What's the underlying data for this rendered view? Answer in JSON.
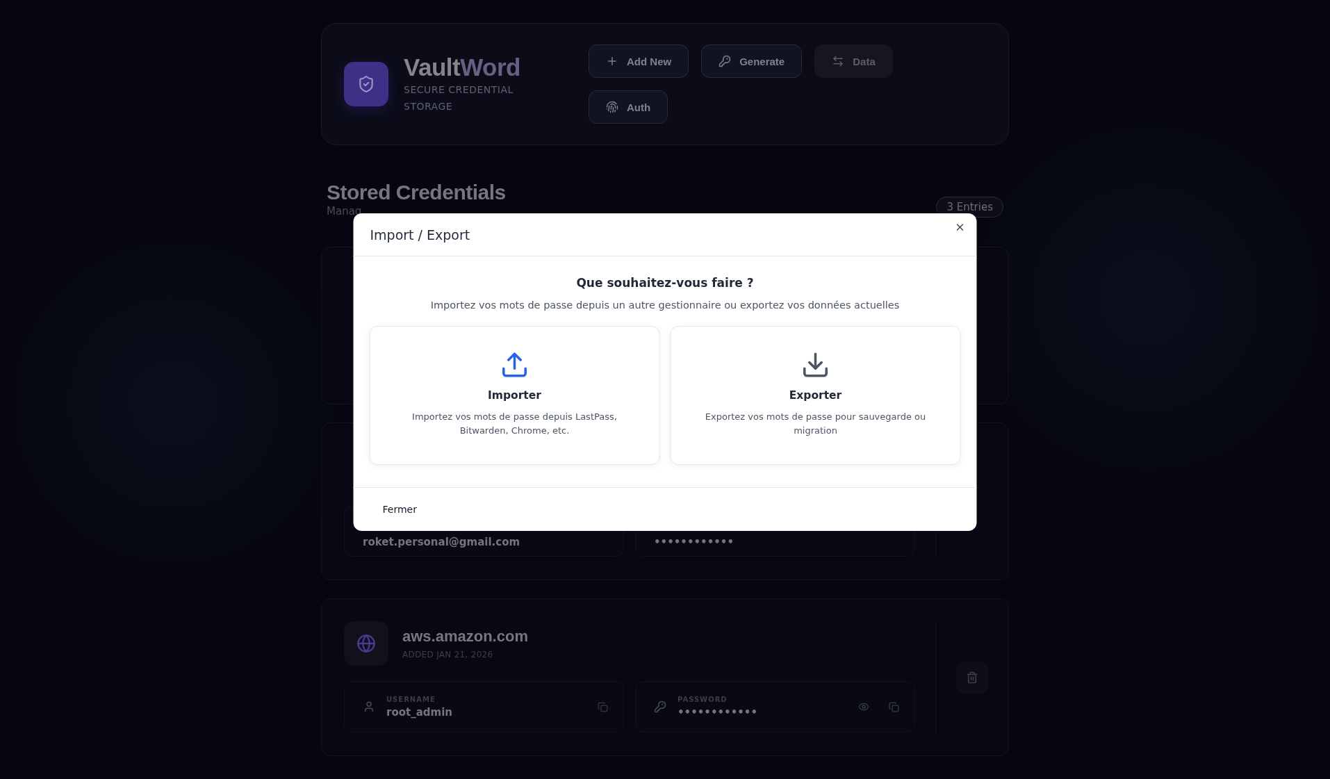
{
  "header": {
    "brand": {
      "first": "Vault",
      "second": "Word"
    },
    "tagline": "SECURE CREDENTIAL STORAGE",
    "actions": [
      {
        "kind": "add",
        "label": "Add New"
      },
      {
        "kind": "generate",
        "label": "Generate"
      },
      {
        "kind": "data",
        "label": "Data"
      },
      {
        "kind": "auth",
        "label": "Auth"
      }
    ]
  },
  "section": {
    "title": "Stored Credentials",
    "subtitle": "Manag",
    "count": "3 Entries"
  },
  "credentials": [
    {
      "kind": "hidden"
    },
    {
      "kind": "partial",
      "username": "roket.personal@gmail.com",
      "password": "••••••••••••"
    },
    {
      "kind": "full",
      "site": "aws.amazon.com",
      "added": "ADDED JAN 21, 2026",
      "username_label": "USERNAME",
      "username": "root_admin",
      "password_label": "PASSWORD",
      "password": "••••••••••••"
    }
  ],
  "dialog": {
    "title": "Import / Export",
    "question": "Que souhaitez-vous faire ?",
    "description": "Importez vos mots de passe depuis un autre gestionnaire ou exportez vos données actuelles",
    "options": [
      {
        "kind": "import",
        "title": "Importer",
        "text": "Importez vos mots de passe depuis LastPass, Bitwarden, Chrome, etc."
      },
      {
        "kind": "export",
        "title": "Exporter",
        "text": "Exportez vos mots de passe pour sauvegarde ou migration"
      }
    ],
    "close_label": "Fermer"
  }
}
